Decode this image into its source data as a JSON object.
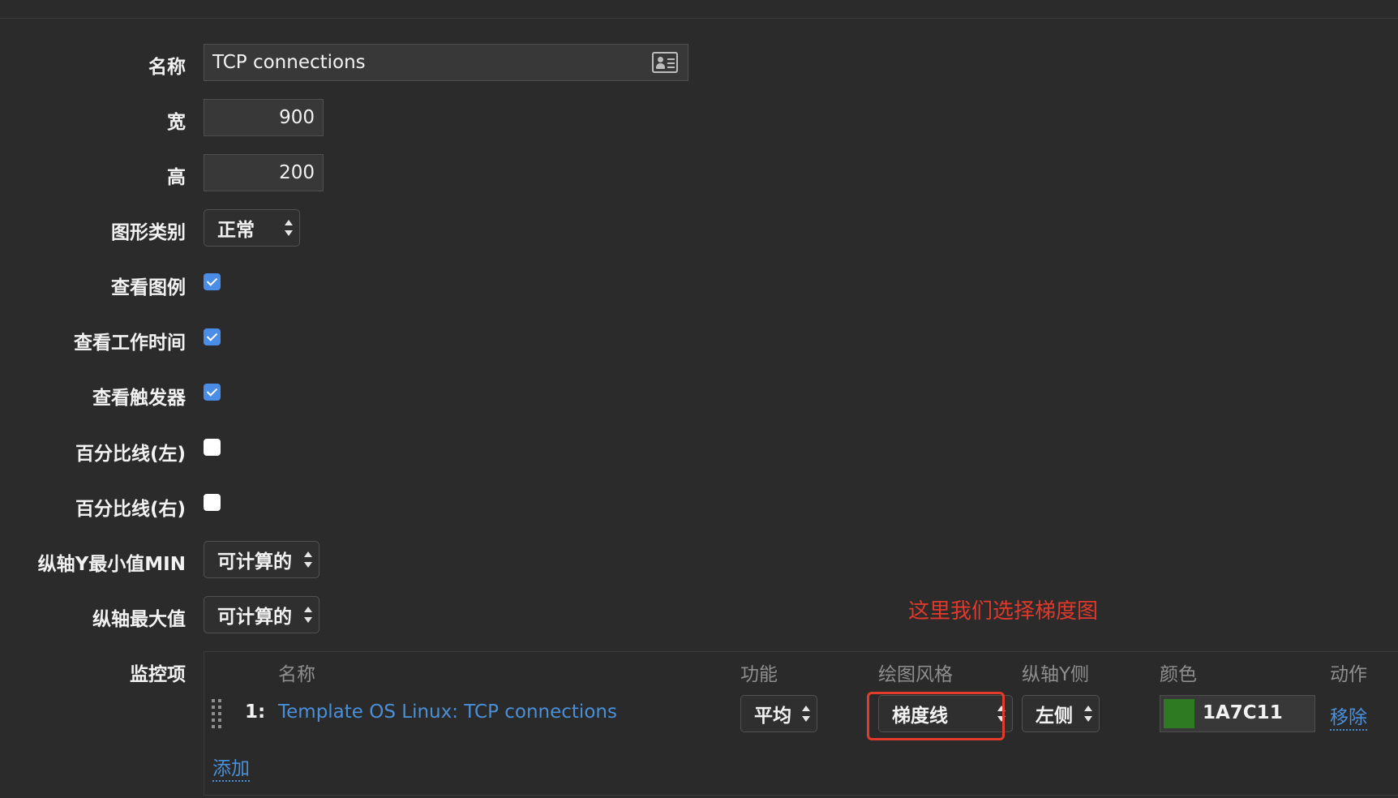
{
  "form": {
    "name_label": "名称",
    "name_value": "TCP connections",
    "width_label": "宽",
    "width_value": "900",
    "height_label": "高",
    "height_value": "200",
    "graph_type_label": "图形类别",
    "graph_type_value": "正常",
    "show_legend_label": "查看图例",
    "show_legend": true,
    "show_working_time_label": "查看工作时间",
    "show_working_time": true,
    "show_triggers_label": "查看触发器",
    "show_triggers": true,
    "percentile_left_label": "百分比线(左)",
    "percentile_left": false,
    "percentile_right_label": "百分比线(右)",
    "percentile_right": false,
    "ymin_label": "纵轴Y最小值MIN",
    "ymin_value": "可计算的",
    "ymax_label": "纵轴最大值",
    "ymax_value": "可计算的"
  },
  "annotation": "这里我们选择梯度图",
  "items": {
    "label": "监控项",
    "columns": [
      "名称",
      "功能",
      "绘图风格",
      "纵轴Y侧",
      "颜色",
      "动作"
    ],
    "rows": [
      {
        "index": "1:",
        "name": "Template OS Linux: TCP connections",
        "function": "平均",
        "draw_style": "梯度线",
        "y_axis_side": "左侧",
        "color": "1A7C11",
        "action": "移除"
      }
    ],
    "add_label": "添加"
  },
  "colors": {
    "background": "#2b2b2b",
    "checkbox_on": "#4a8de6",
    "link": "#4a90d9",
    "annotation": "#e0392b",
    "highlight_border": "#e33b2b",
    "item_swatch": "#2d7a22"
  }
}
